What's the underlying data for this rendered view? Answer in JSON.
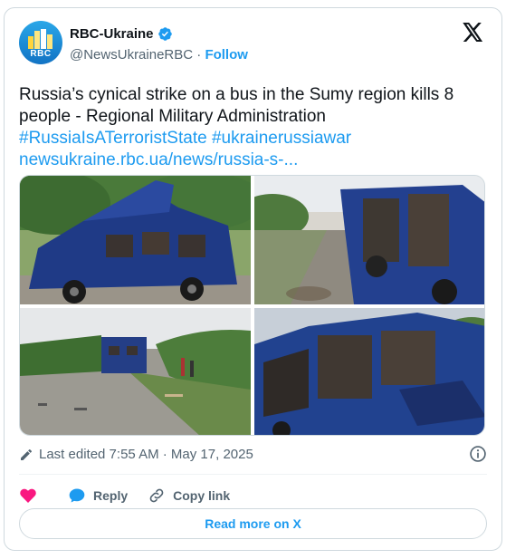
{
  "account": {
    "name": "RBC-Ukraine",
    "handle": "@NewsUkraineRBC",
    "separator": "·",
    "follow_label": "Follow",
    "avatar_text": "RBC"
  },
  "tweet": {
    "text": "Russia’s cynical strike on a bus in the Sumy region kills 8 people - Regional Military Administration",
    "hashtags": "#RussiaIsATerroristState #ukrainerussiawar",
    "link": "newsukraine.rbc.ua/news/russia-s-..."
  },
  "media": {
    "count": 4
  },
  "meta": {
    "edited": "Last edited 7:55 AM · May 17, 2025"
  },
  "actions": {
    "like_label": "",
    "reply_label": "Reply",
    "copy_link_label": "Copy link",
    "read_more_label": "Read more on X"
  },
  "colors": {
    "accent": "#1d9bf0",
    "like": "#f91880",
    "text": "#0f1419",
    "muted": "#536471"
  }
}
